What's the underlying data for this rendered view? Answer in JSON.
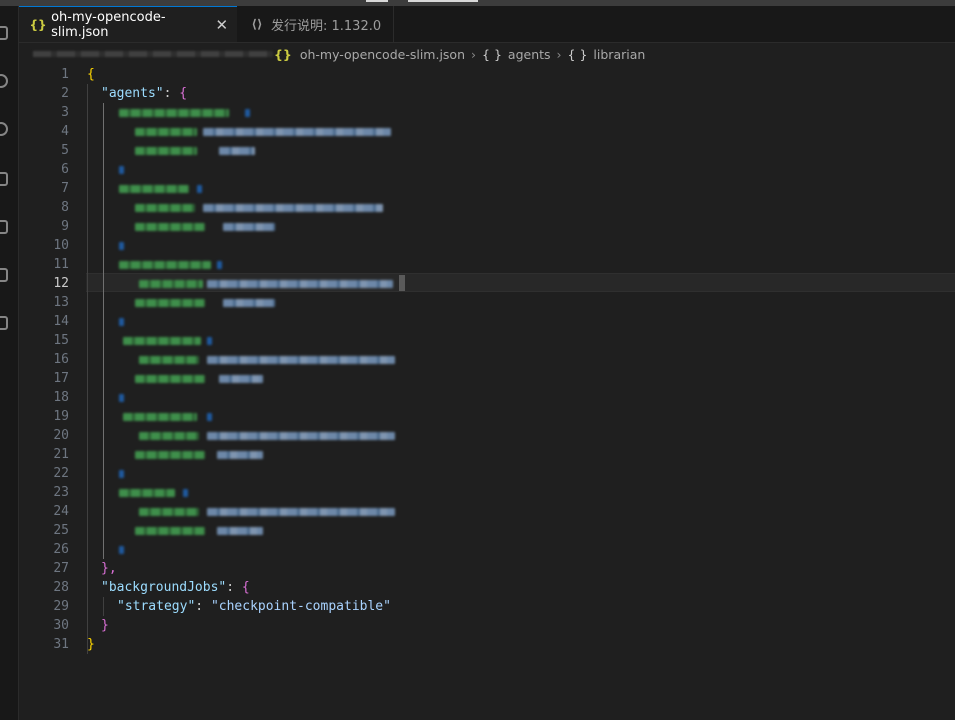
{
  "tabs": [
    {
      "label": "oh-my-opencode-slim.json",
      "icon": "json-file-icon",
      "active": true
    },
    {
      "label": "发行说明: 1.132.0",
      "icon": "vscode-icon",
      "active": false
    }
  ],
  "breadcrumb": [
    {
      "label": "oh-my-opencode-slim.json",
      "icon": "json-file-icon"
    },
    {
      "label": "agents",
      "icon": "object-icon"
    },
    {
      "label": "librarian",
      "icon": "object-icon"
    }
  ],
  "editor": {
    "line_numbers": [
      "1",
      "2",
      "3",
      "4",
      "5",
      "6",
      "7",
      "8",
      "9",
      "10",
      "11",
      "12",
      "13",
      "14",
      "15",
      "16",
      "17",
      "18",
      "19",
      "20",
      "21",
      "22",
      "23",
      "24",
      "25",
      "26",
      "27",
      "28",
      "29",
      "30",
      "31"
    ],
    "current_line": 12,
    "code": {
      "l1_brace": "{",
      "l2_key": "\"agents\"",
      "l2_colon": ": ",
      "l2_brace": "{",
      "l27_close": "},",
      "l28_key": "\"backgroundJobs\"",
      "l28_colon": ": ",
      "l28_brace": "{",
      "l29_key": "\"strategy\"",
      "l29_colon": ": ",
      "l29_value": "\"checkpoint-compatible\"",
      "l30_close": "}",
      "l31_close": "}"
    }
  },
  "colors": {
    "accent": "#0078d4",
    "json_icon": "#cbcb41",
    "string": "#ce9178",
    "property": "#9cdcfe",
    "bracket_level1": "#ffd700",
    "bracket_level2": "#da70d6"
  }
}
